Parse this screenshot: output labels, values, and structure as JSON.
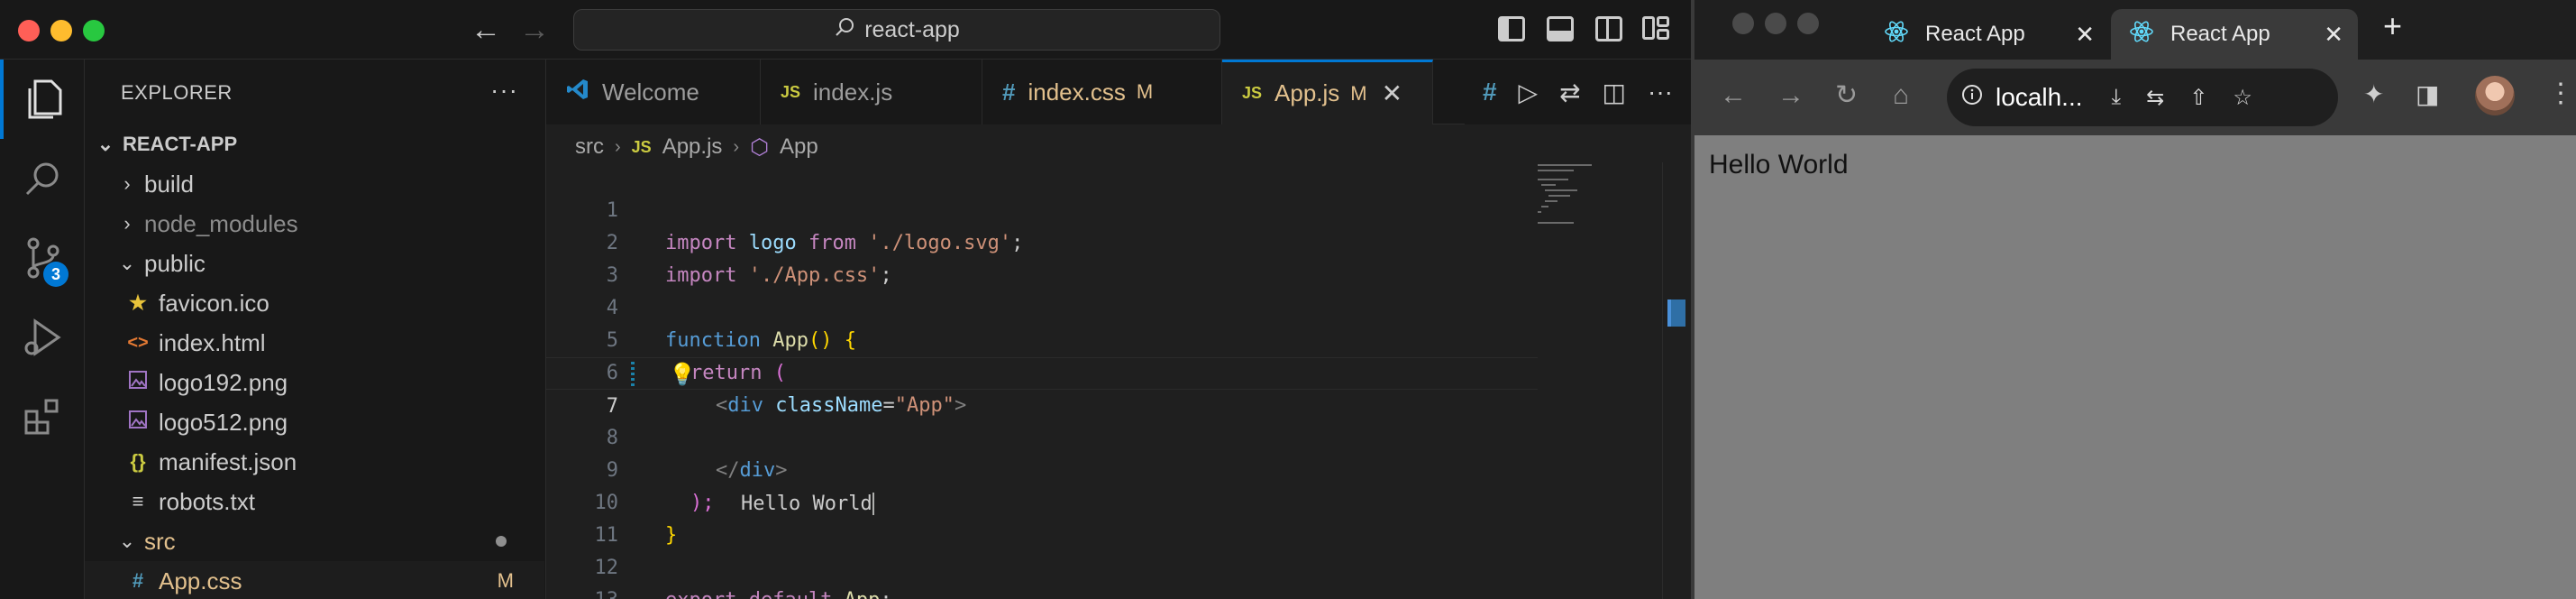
{
  "vscode": {
    "search_label": "react-app",
    "explorer": {
      "title": "EXPLORER",
      "more": "···",
      "root": "REACT-APP",
      "items": [
        {
          "label": "build",
          "type": "folder",
          "depth": 1,
          "expanded": false
        },
        {
          "label": "node_modules",
          "type": "folder",
          "depth": 1,
          "expanded": false,
          "dim": true
        },
        {
          "label": "public",
          "type": "folder",
          "depth": 1,
          "expanded": true
        },
        {
          "label": "favicon.ico",
          "type": "file",
          "depth": 2,
          "icon": "star-icon"
        },
        {
          "label": "index.html",
          "type": "file",
          "depth": 2,
          "icon": "html-icon"
        },
        {
          "label": "logo192.png",
          "type": "file",
          "depth": 2,
          "icon": "image-icon"
        },
        {
          "label": "logo512.png",
          "type": "file",
          "depth": 2,
          "icon": "image-icon"
        },
        {
          "label": "manifest.json",
          "type": "file",
          "depth": 2,
          "icon": "json-icon"
        },
        {
          "label": "robots.txt",
          "type": "file",
          "depth": 2,
          "icon": "text-file-icon"
        },
        {
          "label": "src",
          "type": "folder",
          "depth": 1,
          "expanded": true,
          "dot": true
        },
        {
          "label": "App.css",
          "type": "file",
          "depth": 2,
          "icon": "css-icon",
          "modified": true,
          "flag": "M"
        }
      ]
    },
    "source_control_badge": "3",
    "tabs": [
      {
        "label": "Welcome",
        "icon": "vscode-icon"
      },
      {
        "label": "index.js",
        "icon": "js-icon"
      },
      {
        "label": "index.css",
        "icon": "css-icon",
        "flag": "M"
      },
      {
        "label": "App.js",
        "icon": "js-icon",
        "flag": "M",
        "active": true
      }
    ],
    "breadcrumb": [
      "src",
      "App.js",
      "App"
    ],
    "code_lines": [
      "1",
      "2",
      "3",
      "4",
      "5",
      "6",
      "7",
      "8",
      "9",
      "10",
      "11",
      "12",
      "13"
    ],
    "code": {
      "l1": {
        "kw": "import",
        "id": " logo ",
        "from": "from",
        "str": " './logo.svg'",
        "end": ";"
      },
      "l2": {
        "kw": "import",
        "str": " './App.css'",
        "end": ";"
      },
      "l4": {
        "kw": "function",
        "fn": " App",
        "rest": "() {"
      },
      "l5": {
        "kw": "return",
        "rest": " ("
      },
      "l6": {
        "open": "<",
        "tag": "div",
        "attr": " className",
        "eq": "=",
        "str": "\"App\"",
        "close": ">"
      },
      "l7": {
        "text": "Hello World"
      },
      "l8": {
        "open": "</",
        "tag": "div",
        "close": ">"
      },
      "l9": {
        "rest": ");"
      },
      "l10": {
        "rest": "}"
      },
      "l12": {
        "kw": "export default",
        "fn": " App",
        "end": ";"
      }
    }
  },
  "browser": {
    "tabs": [
      {
        "label": "React App",
        "active": false
      },
      {
        "label": "React App",
        "active": true
      }
    ],
    "url": "localh...",
    "page_text": "Hello World"
  },
  "colors": {
    "accent": "#0078d4",
    "modified": "#e2c08d",
    "browser_bg": "#7f7f7f"
  }
}
